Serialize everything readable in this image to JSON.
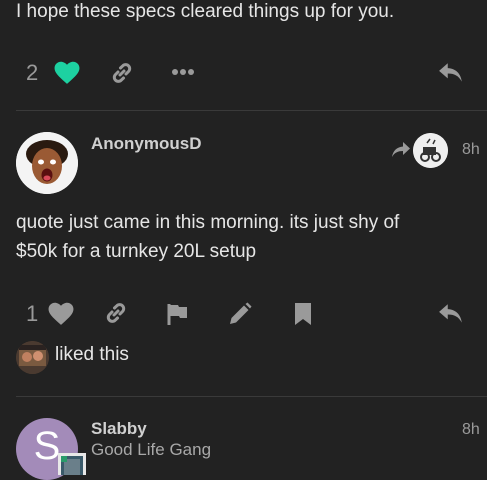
{
  "post1": {
    "text": "I hope these specs cleared things up for you.",
    "like_count": "2"
  },
  "post2": {
    "username": "AnonymousD",
    "time": "8h",
    "text_line1": "quote just came in this morning. its just shy of",
    "text_line2": "$50k for a turnkey 20L setup",
    "like_count": "1",
    "liked_text": "liked this"
  },
  "post3": {
    "username": "Slabby",
    "title": "Good Life Gang",
    "time": "8h",
    "avatar_letter": "S"
  },
  "colors": {
    "background": "#222222",
    "liked_heart": "#1dd1a1",
    "icon_gray": "#9a9a9a",
    "avatar_purple": "#a38bb9"
  }
}
